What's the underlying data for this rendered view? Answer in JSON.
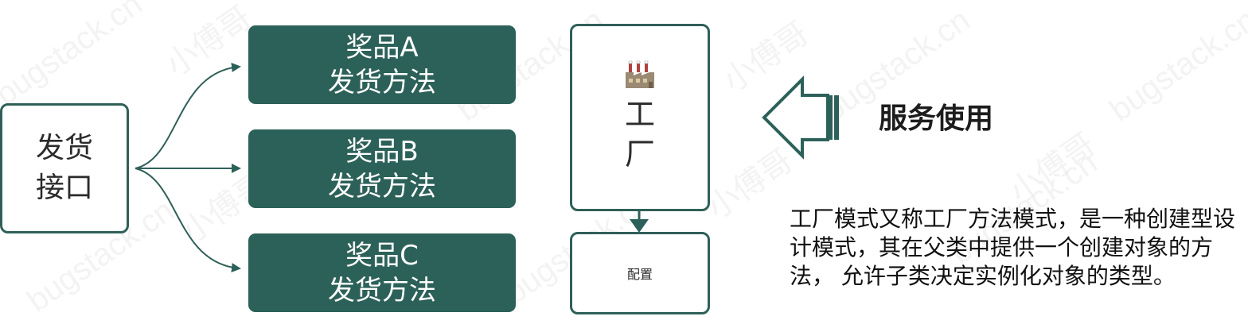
{
  "nodes": {
    "interface": {
      "line1": "发货",
      "line2": "接口"
    },
    "prizes": [
      {
        "line1": "奖品A",
        "line2": "发货方法"
      },
      {
        "line1": "奖品B",
        "line2": "发货方法"
      },
      {
        "line1": "奖品C",
        "line2": "发货方法"
      }
    ],
    "factory": {
      "line1": "工",
      "line2": "厂",
      "icon": "factory-icon"
    },
    "config": {
      "label": "配置"
    }
  },
  "service": {
    "label": "服务使用",
    "icon": "arrow-left-icon"
  },
  "description": "工厂模式又称工厂方法模式，是一种创建型设计模式，其在父类中提供一个创建对象的方法， 允许子类决定实例化对象的类型。",
  "watermark": {
    "text1": "小傅哥",
    "text2": "bugstack.cn"
  },
  "colors": {
    "primary": "#2c6159",
    "border": "#2f6058",
    "text": "#222222"
  }
}
